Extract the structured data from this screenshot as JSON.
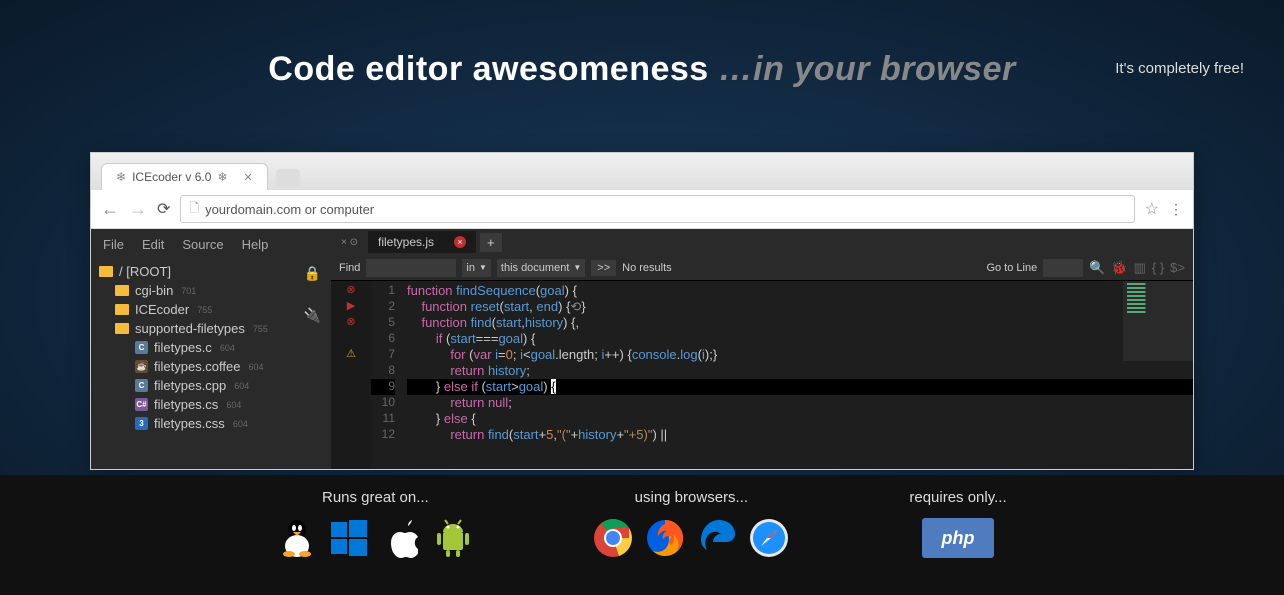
{
  "free_text": "It's completely free!",
  "headline_main": "Code editor awesomeness ",
  "headline_browser": "…in your browser",
  "browser": {
    "tab_title": "ICEcoder v 6.0",
    "url_text": "yourdomain.com or computer"
  },
  "ide": {
    "menu": [
      "File",
      "Edit",
      "Source",
      "Help"
    ],
    "tree": {
      "root": "/ [ROOT]",
      "folders": [
        {
          "name": "cgi-bin",
          "count": "701"
        },
        {
          "name": "ICEcoder",
          "count": "755"
        },
        {
          "name": "supported-filetypes",
          "count": "755"
        }
      ],
      "files": [
        {
          "name": "filetypes.c",
          "ext": "c",
          "icon": "C",
          "count": "604"
        },
        {
          "name": "filetypes.coffee",
          "ext": "coffee",
          "icon": "☕",
          "count": "604"
        },
        {
          "name": "filetypes.cpp",
          "ext": "cpp",
          "icon": "C",
          "count": "604"
        },
        {
          "name": "filetypes.cs",
          "ext": "cs",
          "icon": "C#",
          "count": "604"
        },
        {
          "name": "filetypes.css",
          "ext": "css",
          "icon": "3",
          "count": "604"
        }
      ]
    },
    "active_tab": "filetypes.js",
    "find": {
      "label": "Find",
      "scope1": "in",
      "scope2": "this document",
      "go": ">>",
      "results": "No results",
      "goto_label": "Go to Line"
    },
    "code": {
      "line_numbers": [
        "1",
        "2",
        "5",
        "6",
        "7",
        "8",
        "9",
        "10",
        "11",
        "12"
      ],
      "raw_lines": [
        "function findSequence(goal) {",
        "    function reset(start, end) {🔁}",
        "    function find(start,history) {,",
        "        if (start===goal) {",
        "            for (var i=0; i<goal.length; i++) {console.log(i);}",
        "            return history;",
        "        } else if (start>goal) {",
        "            return null;",
        "        } else {",
        "            return find(start+5,\"(\"+history+\"+5)\") ||"
      ]
    }
  },
  "footer": {
    "sections": [
      {
        "heading": "Runs great on..."
      },
      {
        "heading": "using browsers..."
      },
      {
        "heading": "requires only..."
      }
    ]
  }
}
